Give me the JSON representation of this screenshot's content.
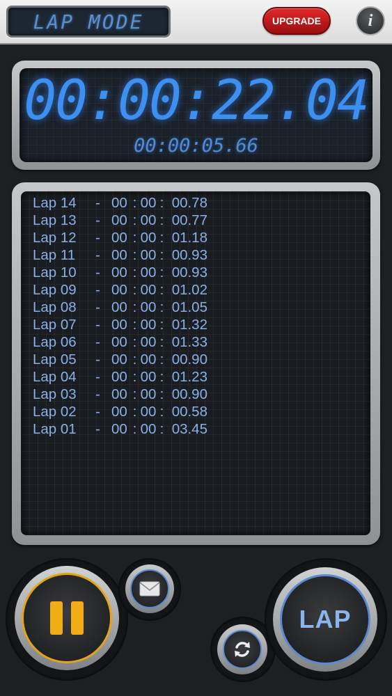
{
  "header": {
    "mode_title": "LAP MODE",
    "upgrade_label": "UPGRADE",
    "info_label": "i"
  },
  "timer": {
    "main_time": "00:00:22.04",
    "current_lap_time": "00:00:05.66"
  },
  "laps": [
    {
      "name": "Lap 14",
      "hh": "00",
      "mm": "00",
      "ss": "00.78"
    },
    {
      "name": "Lap 13",
      "hh": "00",
      "mm": "00",
      "ss": "00.77"
    },
    {
      "name": "Lap 12",
      "hh": "00",
      "mm": "00",
      "ss": "01.18"
    },
    {
      "name": "Lap 11",
      "hh": "00",
      "mm": "00",
      "ss": "00.93"
    },
    {
      "name": "Lap 10",
      "hh": "00",
      "mm": "00",
      "ss": "00.93"
    },
    {
      "name": "Lap 09",
      "hh": "00",
      "mm": "00",
      "ss": "01.02"
    },
    {
      "name": "Lap 08",
      "hh": "00",
      "mm": "00",
      "ss": "01.05"
    },
    {
      "name": "Lap 07",
      "hh": "00",
      "mm": "00",
      "ss": "01.32"
    },
    {
      "name": "Lap 06",
      "hh": "00",
      "mm": "00",
      "ss": "01.33"
    },
    {
      "name": "Lap 05",
      "hh": "00",
      "mm": "00",
      "ss": "00.90"
    },
    {
      "name": "Lap 04",
      "hh": "00",
      "mm": "00",
      "ss": "01.23"
    },
    {
      "name": "Lap 03",
      "hh": "00",
      "mm": "00",
      "ss": "00.90"
    },
    {
      "name": "Lap 02",
      "hh": "00",
      "mm": "00",
      "ss": "00.58"
    },
    {
      "name": "Lap 01",
      "hh": "00",
      "mm": "00",
      "ss": "03.45"
    }
  ],
  "controls": {
    "lap_label": "LAP",
    "pause_icon": "pause-icon",
    "mail_icon": "envelope-icon",
    "reset_icon": "reset-icon"
  },
  "colors": {
    "digit_blue": "#3d8ff0",
    "pause_accent": "#f2ad16",
    "upgrade_red": "#d42022"
  }
}
